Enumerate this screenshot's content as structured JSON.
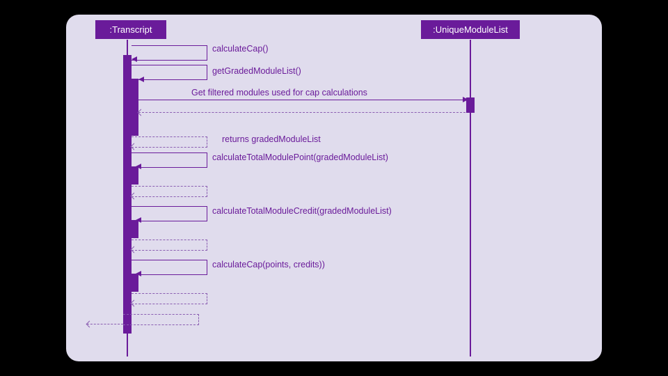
{
  "participants": {
    "transcript": ":Transcript",
    "uniqueModuleList": ":UniqueModuleList"
  },
  "messages": {
    "m1": "calculateCap()",
    "m2": "getGradedModuleList()",
    "m3": "Get filtered modules used for cap calculations",
    "m4": "returns gradedModuleList",
    "m5": "calculateTotalModulePoint(gradedModuleList)",
    "m6": "calculateTotalModuleCredit(gradedModuleList)",
    "m7": "calculateCap(points, credits))"
  }
}
